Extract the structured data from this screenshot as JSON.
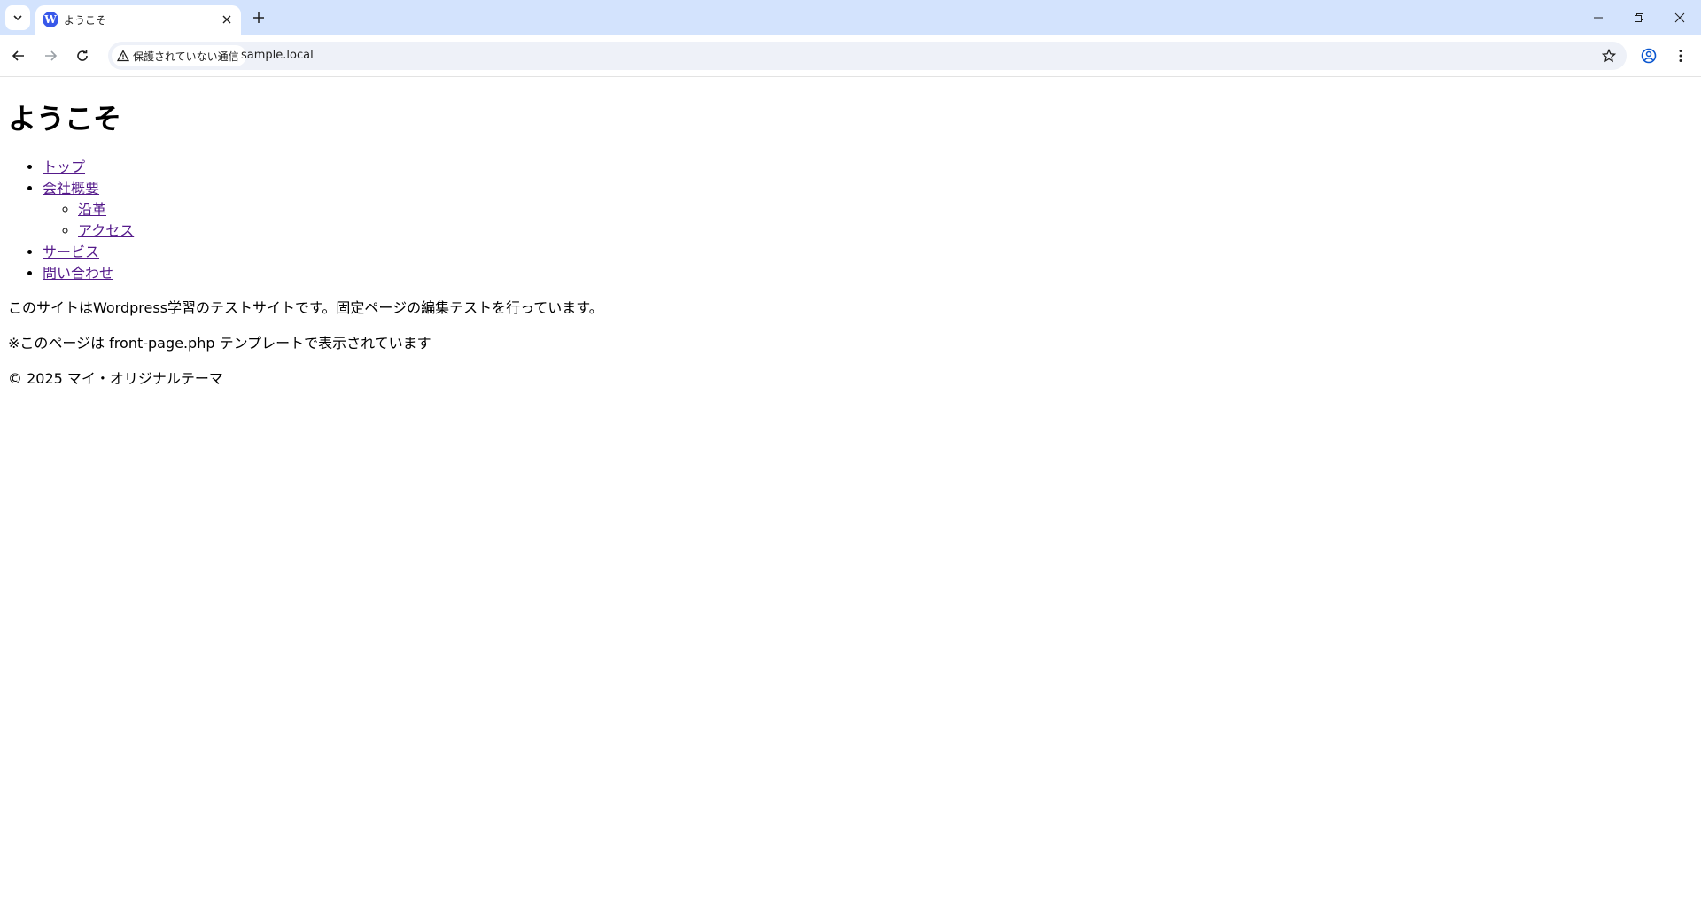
{
  "browser": {
    "tab_title": "ようこそ",
    "security_label": "保護されていない通信",
    "url": "sample.local"
  },
  "page": {
    "heading": "ようこそ",
    "menu": [
      {
        "label": "トップ"
      },
      {
        "label": "会社概要",
        "children": [
          {
            "label": "沿革"
          },
          {
            "label": "アクセス"
          }
        ]
      },
      {
        "label": "サービス"
      },
      {
        "label": "問い合わせ"
      }
    ],
    "intro": "このサイトはWordpress学習のテストサイトです。固定ページの編集テストを行っています。",
    "template_note": "※このページは front-page.php テンプレートで表示されています",
    "footer": "© 2025 マイ・オリジナルテーマ"
  }
}
